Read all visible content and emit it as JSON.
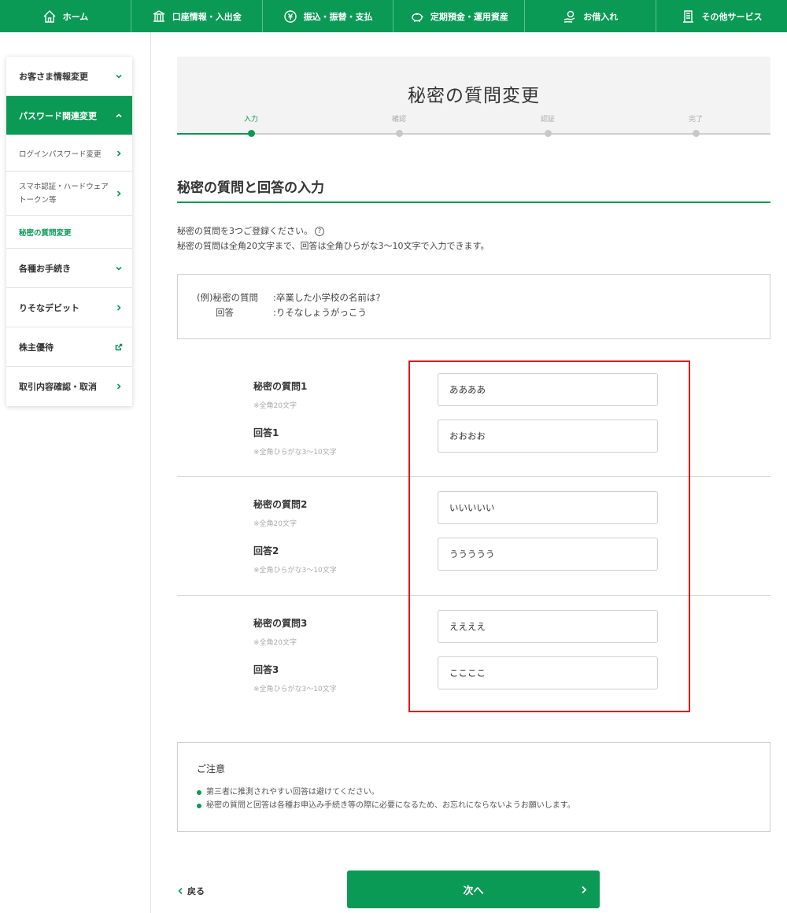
{
  "nav": {
    "items": [
      {
        "label": "ホーム",
        "icon": "home-icon"
      },
      {
        "label": "口座情報・入出金",
        "icon": "bank-icon"
      },
      {
        "label": "振込・振替・支払",
        "icon": "transfer-icon"
      },
      {
        "label": "定期預金・運用資産",
        "icon": "piggy-bank-icon"
      },
      {
        "label": "お借入れ",
        "icon": "loan-icon"
      },
      {
        "label": "その他サービス",
        "icon": "document-icon"
      }
    ]
  },
  "sidebar": {
    "items": [
      {
        "label": "お客さま情報変更"
      },
      {
        "label": "パスワード関連変更"
      },
      {
        "label": "各種お手続き"
      },
      {
        "label": "りそなデビット"
      },
      {
        "label": "株主優待"
      },
      {
        "label": "取引内容確認・取消"
      }
    ],
    "subitems": [
      {
        "label": "ログインパスワード変更"
      },
      {
        "label_line1": "スマホ認証・ハードウェア",
        "label_line2": "トークン等"
      },
      {
        "label": "秘密の質問変更"
      }
    ]
  },
  "header": {
    "title": "秘密の質問変更",
    "steps": [
      "入力",
      "確認",
      "認証",
      "完了"
    ]
  },
  "section": {
    "title": "秘密の質問と回答の入力",
    "desc_line1": "秘密の質問を3つご登録ください。",
    "help_icon": "?",
    "desc_line2": "秘密の質問は全角20文字まで、回答は全角ひらがな3～10文字で入力できます。"
  },
  "example": {
    "q_label": "(例)秘密の質問",
    "q_value": ":卒業した小学校の名前は?",
    "a_label": "回答",
    "a_value": ":りそなしょうがっこう"
  },
  "form": {
    "groups": [
      {
        "q_label": "秘密の質問1",
        "q_note": "※全角20文字",
        "q_value": "ああああ",
        "a_label": "回答1",
        "a_note": "※全角ひらがな3～10文字",
        "a_value": "おおおお"
      },
      {
        "q_label": "秘密の質問2",
        "q_note": "※全角20文字",
        "q_value": "いいいいい",
        "a_label": "回答2",
        "a_note": "※全角ひらがな3～10文字",
        "a_value": "ううううう"
      },
      {
        "q_label": "秘密の質問3",
        "q_note": "※全角20文字",
        "q_value": "ええええ",
        "a_label": "回答3",
        "a_note": "※全角ひらがな3～10文字",
        "a_value": "ここここ"
      }
    ]
  },
  "notice": {
    "title": "ご注意",
    "items": [
      "第三者に推測されやすい回答は避けてください。",
      "秘密の質問と回答は各種お申込み手続き等の際に必要になるため、お忘れにならないようお願いします。"
    ]
  },
  "actions": {
    "back_label": "戻る",
    "next_label": "次へ"
  },
  "colors": {
    "brand": "#0a9a55",
    "highlight": "#e01919"
  }
}
